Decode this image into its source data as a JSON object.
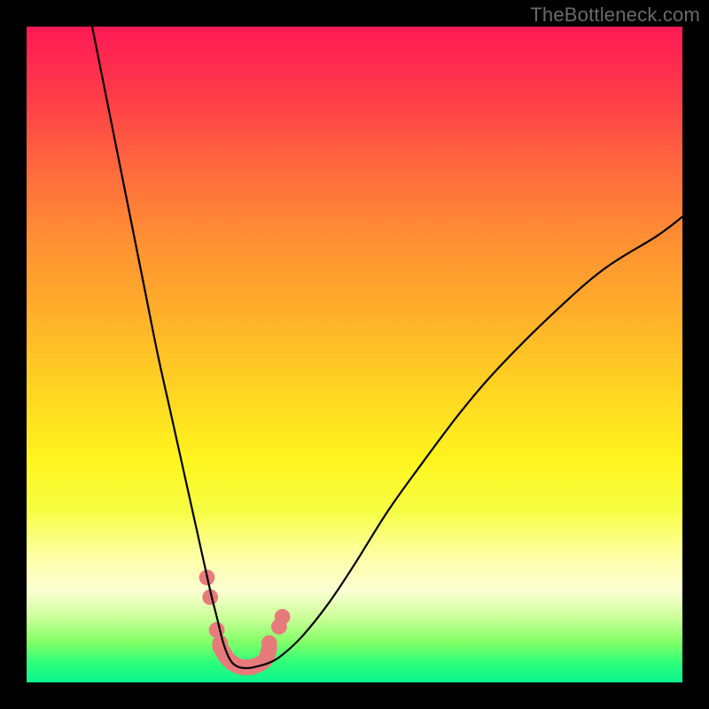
{
  "watermark": {
    "text": "TheBottleneck.com"
  },
  "chart_data": {
    "type": "line",
    "title": "",
    "xlabel": "",
    "ylabel": "",
    "xlim": [
      0,
      100
    ],
    "ylim": [
      0,
      100
    ],
    "grid": false,
    "legend": false,
    "series": [
      {
        "name": "bottleneck-curve",
        "color": "#000000",
        "x": [
          10,
          12,
          14,
          16,
          18,
          20,
          22,
          24,
          26,
          28,
          29,
          30,
          31,
          32,
          33,
          34,
          35,
          37,
          39,
          42,
          46,
          50,
          55,
          60,
          66,
          72,
          80,
          88,
          96,
          100
        ],
        "y": [
          100,
          90,
          80,
          70,
          60,
          50,
          41,
          32,
          23,
          14,
          10,
          6,
          3.5,
          2.5,
          2.2,
          2.2,
          2.4,
          3.0,
          4.2,
          7,
          12,
          18,
          26,
          33,
          41,
          48,
          56,
          63,
          68,
          71
        ]
      }
    ],
    "markers": [
      {
        "name": "pink-dot",
        "x": 27.5,
        "y": 16,
        "r": 1.2,
        "color": "#e77b7b"
      },
      {
        "name": "pink-dot",
        "x": 28.0,
        "y": 13,
        "r": 1.2,
        "color": "#e77b7b"
      },
      {
        "name": "pink-dot",
        "x": 29.0,
        "y": 8,
        "r": 1.2,
        "color": "#e77b7b"
      },
      {
        "name": "pink-dot",
        "x": 29.5,
        "y": 6,
        "r": 1.2,
        "color": "#e77b7b"
      },
      {
        "name": "pink-dot",
        "x": 37.0,
        "y": 6,
        "r": 1.2,
        "color": "#e77b7b"
      },
      {
        "name": "pink-dot",
        "x": 38.5,
        "y": 8.5,
        "r": 1.2,
        "color": "#e77b7b"
      },
      {
        "name": "pink-dot",
        "x": 39.0,
        "y": 10,
        "r": 1.2,
        "color": "#e77b7b"
      }
    ],
    "trough_band": {
      "name": "pink-trough",
      "color": "#e77b7b",
      "x": [
        29.5,
        30.5,
        31.5,
        32.5,
        33.5,
        34.5,
        35.5,
        36.5,
        37.0
      ],
      "y": [
        5.5,
        3.8,
        2.9,
        2.4,
        2.3,
        2.4,
        2.8,
        3.6,
        5.2
      ],
      "width": 2.4
    }
  }
}
